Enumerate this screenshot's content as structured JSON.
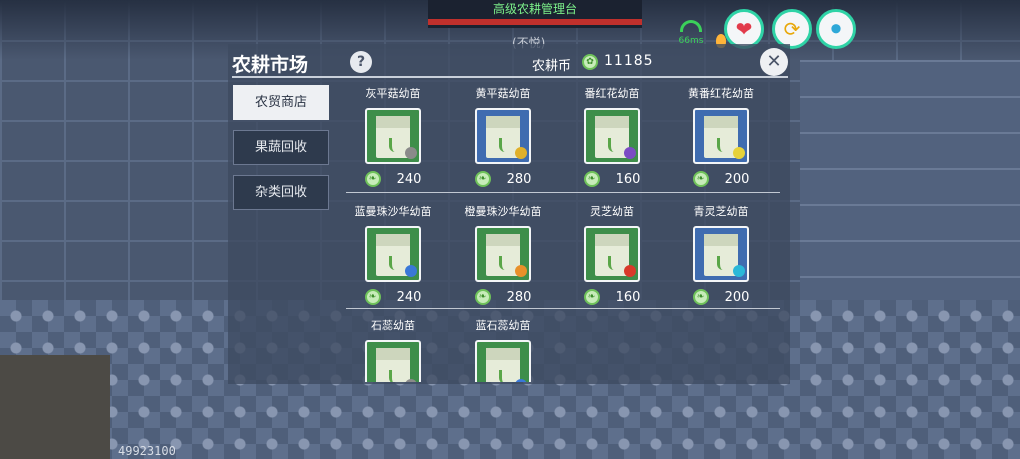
{
  "hud": {
    "top_title": "高级农耕管理台",
    "mood": "(不悦)",
    "ping": "66ms",
    "debug_id": "49923100"
  },
  "panel": {
    "title": "农耕市场",
    "help": "?",
    "coin_label": "农耕币",
    "coin_value": "11185",
    "close": "✕"
  },
  "tabs": [
    {
      "label": "农贸商店",
      "active": true
    },
    {
      "label": "果蔬回收",
      "active": false
    },
    {
      "label": "杂类回收",
      "active": false
    }
  ],
  "items": [
    {
      "name": "灰平菇幼苗",
      "price": "240",
      "card": "green",
      "badge": "#8a8a8a"
    },
    {
      "name": "黄平菇幼苗",
      "price": "280",
      "card": "blue",
      "badge": "#e0b02a"
    },
    {
      "name": "番红花幼苗",
      "price": "160",
      "card": "green",
      "badge": "#7b4cc4"
    },
    {
      "name": "黄番红花幼苗",
      "price": "200",
      "card": "blue",
      "badge": "#e6d23a"
    },
    {
      "name": "蓝曼珠沙华幼苗",
      "price": "240",
      "card": "green",
      "badge": "#3a78d8"
    },
    {
      "name": "橙曼珠沙华幼苗",
      "price": "280",
      "card": "green",
      "badge": "#e8902a"
    },
    {
      "name": "灵芝幼苗",
      "price": "160",
      "card": "green",
      "badge": "#d83a2a"
    },
    {
      "name": "青灵芝幼苗",
      "price": "200",
      "card": "blue",
      "badge": "#2ab8d8"
    },
    {
      "name": "石蕊幼苗",
      "price": "",
      "card": "green",
      "badge": "#8a8a8a"
    },
    {
      "name": "蓝石蕊幼苗",
      "price": "",
      "card": "green",
      "badge": "#3a78d8"
    }
  ]
}
